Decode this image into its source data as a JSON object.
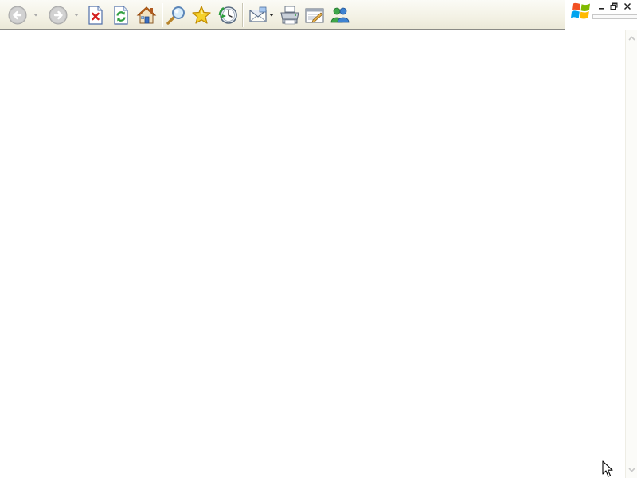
{
  "toolbar": {
    "buttons": [
      {
        "name": "back-button",
        "icon": "back-arrow-icon",
        "enabled": false,
        "has_dropdown": true
      },
      {
        "name": "forward-button",
        "icon": "forward-arrow-icon",
        "enabled": false,
        "has_dropdown": true
      },
      {
        "name": "stop-button",
        "icon": "stop-icon"
      },
      {
        "name": "refresh-button",
        "icon": "refresh-icon"
      },
      {
        "name": "home-button",
        "icon": "home-icon"
      },
      {
        "name": "search-button",
        "icon": "search-icon"
      },
      {
        "name": "favorites-button",
        "icon": "favorites-star-icon"
      },
      {
        "name": "history-button",
        "icon": "history-icon"
      },
      {
        "name": "mail-button",
        "icon": "mail-icon",
        "has_dropdown": true
      },
      {
        "name": "print-button",
        "icon": "printer-icon"
      },
      {
        "name": "edit-button",
        "icon": "edit-icon"
      },
      {
        "name": "messenger-button",
        "icon": "messenger-icon"
      }
    ]
  },
  "window_controls": [
    "minimize-icon",
    "restore-icon",
    "close-icon"
  ],
  "brand": {
    "icon": "windows-logo-icon"
  },
  "colors": {
    "toolbar_top": "#fbfbf6",
    "toolbar_bottom": "#ebe8d7",
    "content_background": "#ffffff",
    "accent_green": "#2e9e3e",
    "accent_red": "#d42020",
    "favorites_yellow": "#f6c400"
  }
}
